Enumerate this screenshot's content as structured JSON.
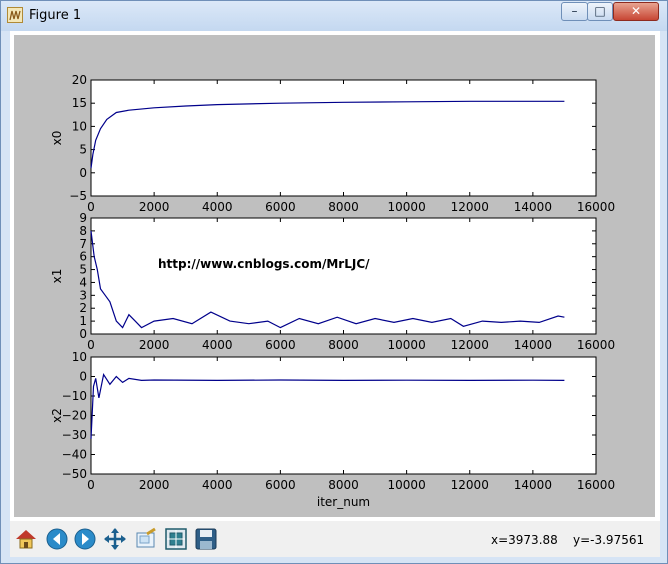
{
  "window": {
    "title": "Figure 1",
    "minimize_glyph": "–",
    "maximize_glyph": "□",
    "close_glyph": "✕"
  },
  "status": {
    "x_readout": "x=3973.88",
    "y_readout": "y=-3.97561"
  },
  "toolbar": {
    "icons": [
      "home-icon",
      "back-icon",
      "forward-icon",
      "pan-icon",
      "zoom-icon",
      "subplots-icon",
      "save-icon"
    ]
  },
  "colors": {
    "figure_background": "#bfbfbf",
    "axes_background": "#ffffff",
    "line": "#00008b",
    "annotation": "#cc0000"
  },
  "chart_data": [
    {
      "type": "line",
      "title": "",
      "xlabel": "",
      "ylabel": "x0",
      "xlim": [
        0,
        16000
      ],
      "ylim": [
        -5,
        20
      ],
      "xticks": [
        "0",
        "2000",
        "4000",
        "6000",
        "8000",
        "10000",
        "12000",
        "14000",
        "16000"
      ],
      "yticks": [
        "−5",
        "0",
        "5",
        "10",
        "15",
        "20"
      ],
      "grid": false,
      "series": [
        {
          "x": [
            0,
            60,
            150,
            300,
            500,
            800,
            1200,
            2000,
            3000,
            4000,
            6000,
            8000,
            10000,
            12000,
            14000,
            15000
          ],
          "values": [
            1,
            4,
            7,
            9.5,
            11.5,
            13,
            13.5,
            14,
            14.4,
            14.7,
            15,
            15.2,
            15.3,
            15.4,
            15.4,
            15.4
          ]
        }
      ]
    },
    {
      "type": "line",
      "title": "",
      "xlabel": "",
      "ylabel": "x1",
      "xlim": [
        0,
        16000
      ],
      "ylim": [
        0,
        9
      ],
      "xticks": [
        "0",
        "2000",
        "4000",
        "6000",
        "8000",
        "10000",
        "12000",
        "14000",
        "16000"
      ],
      "yticks": [
        "0",
        "1",
        "2",
        "3",
        "4",
        "5",
        "6",
        "7",
        "8",
        "9"
      ],
      "grid": false,
      "annotation": "http://www.cnblogs.com/MrLJC/",
      "series": [
        {
          "x": [
            0,
            50,
            100,
            200,
            300,
            450,
            600,
            800,
            1000,
            1200,
            1400,
            1600,
            2000,
            2600,
            3200,
            3800,
            4400,
            5000,
            5600,
            6000,
            6600,
            7200,
            7800,
            8400,
            9000,
            9600,
            10200,
            10800,
            11400,
            11800,
            12400,
            13000,
            13600,
            14200,
            14800,
            15000
          ],
          "values": [
            8,
            7,
            6,
            5,
            3.5,
            3,
            2.5,
            1,
            0.5,
            1.5,
            1,
            0.5,
            1,
            1.2,
            0.8,
            1.7,
            1,
            0.8,
            1,
            0.5,
            1.2,
            0.8,
            1.3,
            0.8,
            1.2,
            0.9,
            1.2,
            0.9,
            1.2,
            0.6,
            1,
            0.9,
            1,
            0.9,
            1.4,
            1.3
          ]
        }
      ]
    },
    {
      "type": "line",
      "title": "",
      "xlabel": "iter_num",
      "ylabel": "x2",
      "xlim": [
        0,
        16000
      ],
      "ylim": [
        -50,
        10
      ],
      "xticks": [
        "0",
        "2000",
        "4000",
        "6000",
        "8000",
        "10000",
        "12000",
        "14000",
        "16000"
      ],
      "yticks": [
        "−50",
        "−40",
        "−30",
        "−20",
        "−10",
        "0",
        "10"
      ],
      "grid": false,
      "series": [
        {
          "x": [
            0,
            40,
            80,
            150,
            250,
            400,
            600,
            800,
            1000,
            1200,
            1600,
            2000,
            4000,
            6000,
            8000,
            10000,
            12000,
            14000,
            15000
          ],
          "values": [
            -32,
            -18,
            -5,
            -1,
            -11,
            1,
            -4,
            0,
            -3,
            -1,
            -2,
            -1.8,
            -2,
            -1.8,
            -2,
            -1.9,
            -2,
            -1.9,
            -2
          ]
        }
      ]
    }
  ]
}
